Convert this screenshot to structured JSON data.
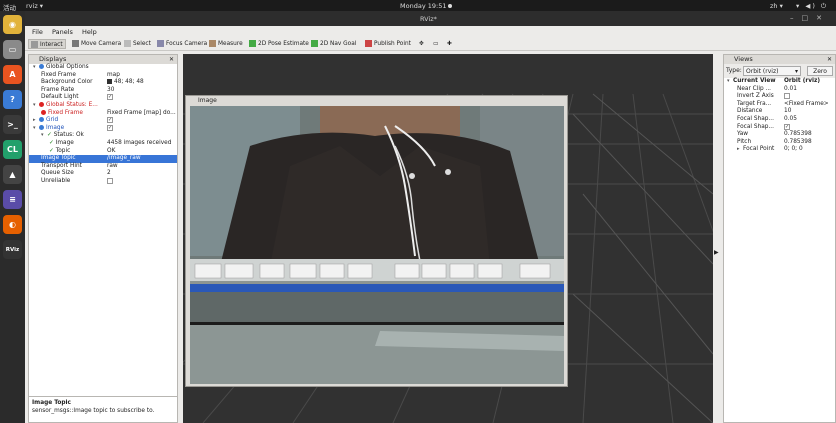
{
  "system": {
    "activities": "活动",
    "app_name": "rviz ▾",
    "clock": "Monday 19:51",
    "lang": "zh ▾",
    "icons": "▾ ◀) ⏻"
  },
  "window": {
    "title": "RViz*"
  },
  "menu": [
    "File",
    "Panels",
    "Help"
  ],
  "toolbar": [
    {
      "label": "Interact",
      "icon": "interact-icon",
      "active": true
    },
    {
      "label": "Move Camera",
      "icon": "move-camera-icon"
    },
    {
      "label": "Select",
      "icon": "select-icon"
    },
    {
      "label": "Focus Camera",
      "icon": "focus-camera-icon"
    },
    {
      "label": "Measure",
      "icon": "measure-icon"
    },
    {
      "label": "2D Pose Estimate",
      "icon": "pose-estimate-icon"
    },
    {
      "label": "2D Nav Goal",
      "icon": "nav-goal-icon"
    },
    {
      "label": "Publish Point",
      "icon": "publish-point-icon"
    }
  ],
  "displays": {
    "title": "Displays",
    "rows": [
      {
        "k": "Global Options",
        "indent": 1,
        "arrow": "▾",
        "icon": "blue"
      },
      {
        "k": "Fixed Frame",
        "v": "map",
        "indent": 2
      },
      {
        "k": "Background Color",
        "v": "48; 48; 48",
        "indent": 2,
        "swatch": true
      },
      {
        "k": "Frame Rate",
        "v": "30",
        "indent": 2
      },
      {
        "k": "Default Light",
        "v": "✓",
        "indent": 2,
        "check": true
      },
      {
        "k": "Global Status: E...",
        "indent": 1,
        "arrow": "▾",
        "icon": "red",
        "red": true
      },
      {
        "k": "Fixed Frame",
        "v": "Fixed Frame [map] do...",
        "indent": 2,
        "icon": "red",
        "red": true
      },
      {
        "k": "Grid",
        "v": "✓",
        "indent": 1,
        "arrow": "▸",
        "icon": "blue",
        "check": true,
        "blue": true
      },
      {
        "k": "Image",
        "v": "✓",
        "indent": 1,
        "arrow": "▾",
        "icon": "blue",
        "check": true,
        "blue": true
      },
      {
        "k": "Status: Ok",
        "indent": 2,
        "arrow": "▾",
        "ok": true
      },
      {
        "k": "Image",
        "v": "4458 images received",
        "indent": 3,
        "ok": true
      },
      {
        "k": "Topic",
        "v": "OK",
        "indent": 3,
        "ok": true
      },
      {
        "k": "Image Topic",
        "v": "/image_raw",
        "indent": 2,
        "sel": true
      },
      {
        "k": "Transport Hint",
        "v": "raw",
        "indent": 2
      },
      {
        "k": "Queue Size",
        "v": "2",
        "indent": 2
      },
      {
        "k": "Unreliable",
        "v": "",
        "indent": 2,
        "check": true
      }
    ]
  },
  "description": {
    "title": "Image Topic",
    "text": "sensor_msgs::Image topic to subscribe to."
  },
  "image_panel": {
    "title": "Image"
  },
  "views": {
    "title": "Views",
    "type_label": "Type:",
    "type_value": "Orbit (rviz)",
    "zero_label": "Zero",
    "rows": [
      {
        "k": "Current View",
        "v": "Orbit (rviz)",
        "indent": 0,
        "arrow": "▾",
        "bold": true
      },
      {
        "k": "Near Clip ...",
        "v": "0.01",
        "indent": 1
      },
      {
        "k": "Invert Z Axis",
        "v": "",
        "indent": 1,
        "check": true
      },
      {
        "k": "Target Fra...",
        "v": "<Fixed Frame>",
        "indent": 1
      },
      {
        "k": "Distance",
        "v": "10",
        "indent": 1
      },
      {
        "k": "Focal Shap...",
        "v": "0.05",
        "indent": 1
      },
      {
        "k": "Focal Shap...",
        "v": "✓",
        "indent": 1,
        "check": true
      },
      {
        "k": "Yaw",
        "v": "0.785398",
        "indent": 1
      },
      {
        "k": "Pitch",
        "v": "0.785398",
        "indent": 1
      },
      {
        "k": "Focal Point",
        "v": "0; 0; 0",
        "indent": 1,
        "arrow": "▸"
      }
    ]
  },
  "dock": [
    {
      "name": "chrome-icon",
      "color": "#e2b33a",
      "glyph": "◉"
    },
    {
      "name": "files-icon",
      "color": "#8a8a8a",
      "glyph": "▭"
    },
    {
      "name": "software-icon",
      "color": "#e95420",
      "glyph": "A"
    },
    {
      "name": "help-icon",
      "color": "#3a7bd5",
      "glyph": "?"
    },
    {
      "name": "terminal-icon",
      "color": "#3a3a3a",
      "glyph": ">_"
    },
    {
      "name": "clion-icon",
      "color": "#22a06b",
      "glyph": "CL"
    },
    {
      "name": "inkscape-icon",
      "color": "#444",
      "glyph": "▲"
    },
    {
      "name": "editor-icon",
      "color": "#5a4ca8",
      "glyph": "≡"
    },
    {
      "name": "firefox-icon",
      "color": "#e66000",
      "glyph": "◐"
    },
    {
      "name": "rviz-icon",
      "color": "#333",
      "glyph": "RViz"
    }
  ]
}
